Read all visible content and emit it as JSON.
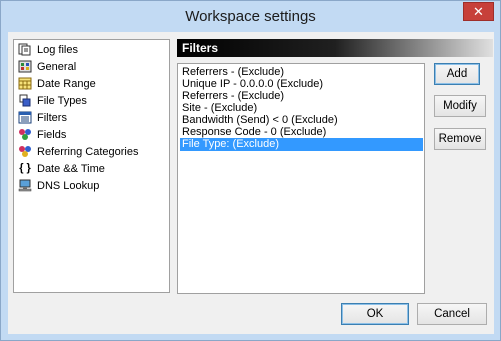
{
  "window": {
    "title": "Workspace settings",
    "close_glyph": "✕"
  },
  "nav": {
    "items": [
      {
        "label": "Log files",
        "icon": "log-files-icon"
      },
      {
        "label": "General",
        "icon": "general-icon"
      },
      {
        "label": "Date Range",
        "icon": "calendar-icon"
      },
      {
        "label": "File Types",
        "icon": "file-types-icon"
      },
      {
        "label": "Filters",
        "icon": "filters-icon"
      },
      {
        "label": "Fields",
        "icon": "fields-icon"
      },
      {
        "label": "Referring Categories",
        "icon": "referring-categories-icon"
      },
      {
        "label": "Date && Time",
        "icon": "braces-icon",
        "glyph": "{ }"
      },
      {
        "label": "DNS Lookup",
        "icon": "computer-icon"
      }
    ]
  },
  "panel": {
    "header": "Filters"
  },
  "filters": [
    "Referrers -  (Exclude)",
    "Unique IP - 0.0.0.0 (Exclude)",
    "Referrers -  (Exclude)",
    "Site -  (Exclude)",
    "Bandwidth (Send) < 0 (Exclude)",
    "Response Code - 0 (Exclude)",
    "File Type: (Exclude)"
  ],
  "selected_filter_index": 6,
  "buttons": {
    "add": "Add",
    "modify": "Modify",
    "remove": "Remove",
    "ok": "OK",
    "cancel": "Cancel"
  },
  "colors": {
    "frame": "#c2daf3",
    "selection": "#3399ff",
    "close": "#c7403a"
  }
}
